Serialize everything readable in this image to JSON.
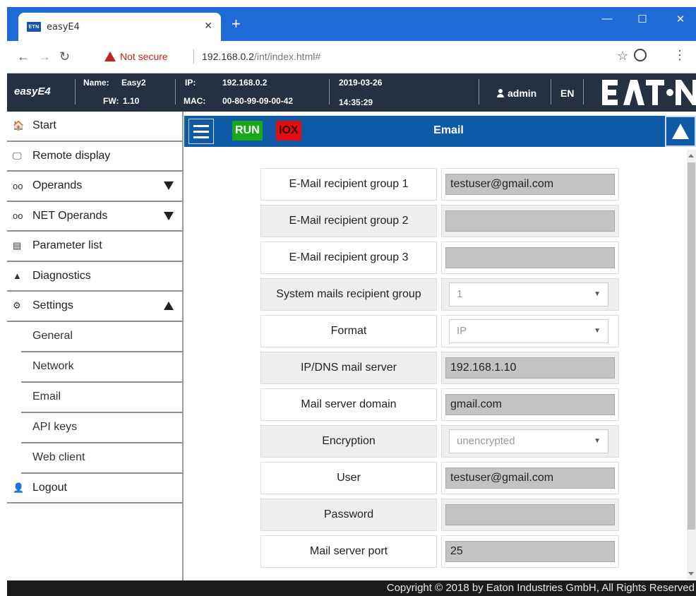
{
  "browser": {
    "tab_title": "easyE4",
    "tab_favicon_text": "ETN",
    "new_tab": "+",
    "security_label": "Not secure",
    "url_host": "192.168.0.2",
    "url_path": "/int/index.html#",
    "window_minimize": "—",
    "window_maximize": "☐",
    "window_close": "✕"
  },
  "header": {
    "brand": "easyE4",
    "name_label": "Name:",
    "name_value": "Easy2",
    "fw_label": "FW:",
    "fw_value": "1.10",
    "ip_label": "IP:",
    "ip_value": "192.168.0.2",
    "mac_label": "MAC:",
    "mac_value": "00-80-99-09-00-42",
    "date": "2019-03-26",
    "time": "14:35:29",
    "user": "admin",
    "language": "EN",
    "logo_text": "EATON"
  },
  "sidebar": {
    "items": [
      {
        "icon": "home-icon",
        "glyph": "🏠",
        "label": "Start"
      },
      {
        "icon": "monitor-icon",
        "glyph": "🖵",
        "label": "Remote display"
      },
      {
        "icon": "glasses-icon",
        "glyph": "oo",
        "label": "Operands"
      },
      {
        "icon": "glasses-icon",
        "glyph": "oo",
        "label": "NET Operands"
      },
      {
        "icon": "list-icon",
        "glyph": "▤",
        "label": "Parameter list"
      },
      {
        "icon": "warning-icon",
        "glyph": "▲",
        "label": "Diagnostics"
      },
      {
        "icon": "gear-icon",
        "glyph": "⚙",
        "label": "Settings"
      }
    ],
    "sub_items": [
      "General",
      "Network",
      "Email",
      "API keys",
      "Web client"
    ],
    "logout": "Logout"
  },
  "toolbar": {
    "run": "RUN",
    "iox": "IOX",
    "title": "Email"
  },
  "form": {
    "rows": [
      {
        "label": "E-Mail recipient group 1",
        "value": "testuser@gmail.com"
      },
      {
        "label": "E-Mail recipient group 2",
        "value": ""
      },
      {
        "label": "E-Mail recipient group 3",
        "value": ""
      },
      {
        "label": "System mails recipient group",
        "value": "1"
      },
      {
        "label": "Format",
        "value": "IP"
      },
      {
        "label": "IP/DNS mail server",
        "value": "192.168.1.10"
      },
      {
        "label": "Mail server domain",
        "value": "gmail.com"
      },
      {
        "label": "Encryption",
        "value": "unencrypted"
      },
      {
        "label": "User",
        "value": "testuser@gmail.com"
      },
      {
        "label": "Password",
        "value": ""
      },
      {
        "label": "Mail server port",
        "value": "25"
      }
    ]
  },
  "footer": {
    "copyright": "Copyright © 2018 by Eaton Industries GmbH, All Rights Reserved"
  },
  "colors": {
    "titlebar": "#1e6ad6",
    "header_bg": "#253040",
    "toolbar_bg": "#0e5aa7",
    "run_green": "#1aa81a",
    "iox_red": "#e01010",
    "footer_bg": "#1b1b1b"
  }
}
